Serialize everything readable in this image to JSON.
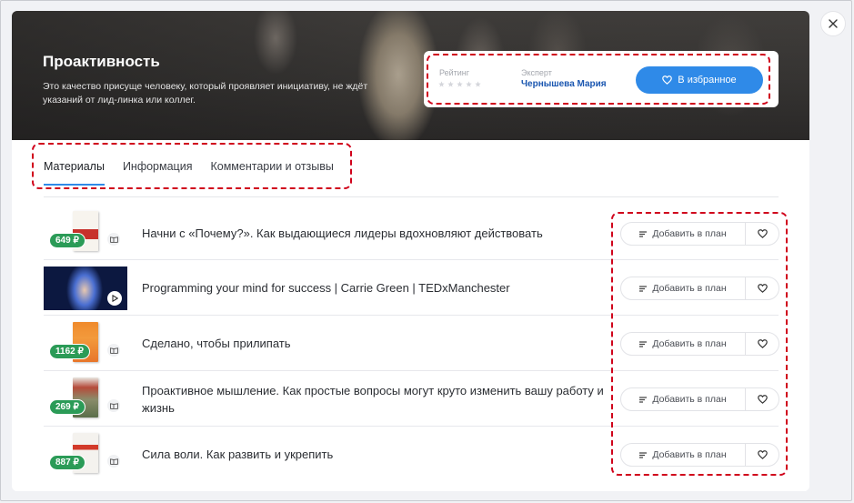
{
  "hero": {
    "title": "Проактивность",
    "description": "Это качество присуще человеку, который проявляет инициативу, не ждёт указаний от лид-линка или коллег."
  },
  "info": {
    "rating_label": "Рейтинг",
    "rating_value": 0,
    "rating_max": 5,
    "expert_label": "Эксперт",
    "expert_name": "Чернышева Мария",
    "favorite_label": "В избранное"
  },
  "tabs": [
    {
      "label": "Материалы",
      "active": true
    },
    {
      "label": "Информация",
      "active": false
    },
    {
      "label": "Комментарии и отзывы",
      "active": false
    }
  ],
  "materials": [
    {
      "title": "Начни с «Почему?». Как выдающиеся лидеры вдохновляют действовать",
      "price": "649 ₽",
      "kind": "book"
    },
    {
      "title": "Programming your mind for success | Carrie Green | TEDxManchester",
      "price": "",
      "kind": "video"
    },
    {
      "title": "Сделано, чтобы прилипать",
      "price": "1162 ₽",
      "kind": "book"
    },
    {
      "title": "Проактивное мышление. Как простые вопросы могут круто изменить вашу работу и жизнь",
      "price": "269 ₽",
      "kind": "book"
    },
    {
      "title": "Сила воли. Как развить и укрепить",
      "price": "887 ₽",
      "kind": "book"
    }
  ],
  "actions": {
    "add_to_plan_label": "Добавить в план"
  },
  "colors": {
    "accent": "#2f8ae8",
    "price_badge": "#2b9b57",
    "expert_link": "#1a56b0",
    "annotation": "#d0021b"
  },
  "icons": {
    "close": "close-icon",
    "favorite": "heart-icon",
    "plan": "list-icon",
    "book": "book-icon",
    "play": "play-icon"
  }
}
